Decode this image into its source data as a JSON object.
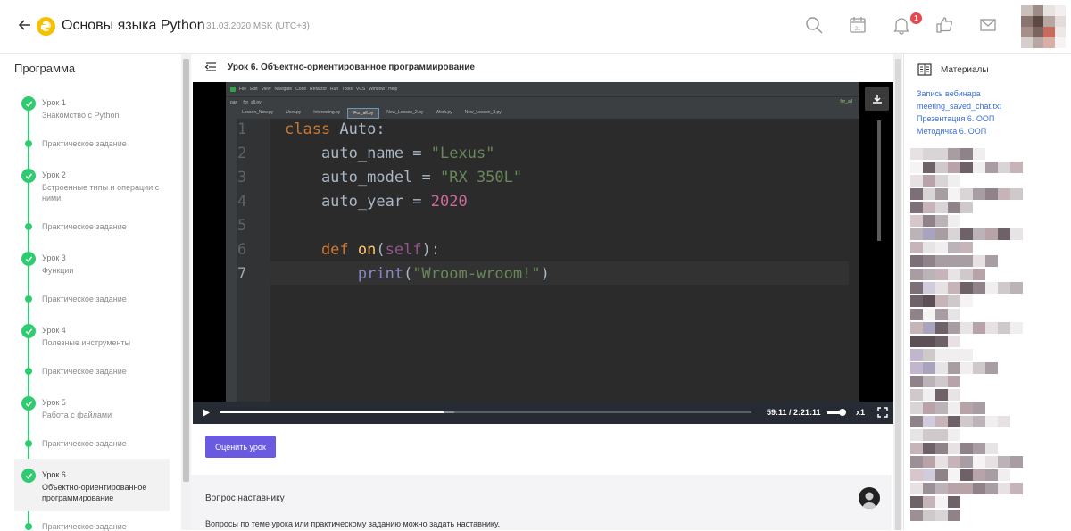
{
  "header": {
    "course_title": "Основы языка Python",
    "course_date": "31.03.2020 MSK (UTC+3)",
    "notification_count": "1"
  },
  "sidebar": {
    "title": "Программа",
    "lessons": [
      {
        "name": "Урок 1",
        "subtitle": "Знакомство с Python",
        "practice": "Практическое задание"
      },
      {
        "name": "Урок 2",
        "subtitle": "Встроенные типы и операции с ними",
        "practice": "Практическое задание"
      },
      {
        "name": "Урок 3",
        "subtitle": "Функции",
        "practice": "Практическое задание"
      },
      {
        "name": "Урок 4",
        "subtitle": "Полезные инструменты",
        "practice": "Практическое задание"
      },
      {
        "name": "Урок 5",
        "subtitle": "Работа с файлами",
        "practice": "Практическое задание"
      },
      {
        "name": "Урок 6",
        "subtitle": "Объектно-ориентированное программирование",
        "practice": "Практическое задание"
      }
    ]
  },
  "main": {
    "lesson_title": "Урок 6. Объектно-ориентированное программирование",
    "rate_button": "Оценить урок",
    "question_title": "Вопрос наставнику",
    "question_text": "Вопросы по теме урока или практическому заданию можно задать наставнику."
  },
  "video": {
    "time": "59:11 / 2:21:11",
    "speed": "x1",
    "progress": 0.42,
    "ide": {
      "menu": [
        "File",
        "Edit",
        "View",
        "Navigate",
        "Code",
        "Refactor",
        "Run",
        "Tools",
        "VCS",
        "Window",
        "Help"
      ],
      "project": "pan",
      "file": "for_all.py",
      "run_config": "for_all",
      "tabs": [
        "Lesson_Now.py",
        "User.py",
        "Interesting.py",
        "For_all.py",
        "New_Lesson_2.py",
        "Work.py",
        "New_Lesson_3.py"
      ],
      "active_tab": 3,
      "line_numbers": [
        "1",
        "2",
        "3",
        "4",
        "5",
        "6",
        "7"
      ],
      "code": {
        "l1_kw": "class",
        "l1_name": " Auto:",
        "l2_name": "    auto_name = ",
        "l2_str": "\"Lexus\"",
        "l3_name": "    auto_model = ",
        "l3_str": "\"RX 350L\"",
        "l4_name": "    auto_year = ",
        "l4_num": "2020",
        "l6_kw": "    def",
        "l6_fn": " on",
        "l6_p1": "(",
        "l6_self": "self",
        "l6_p2": "):",
        "l7_bi": "        print",
        "l7_p1": "(",
        "l7_str": "\"Wroom-wroom!\"",
        "l7_p2": ")"
      }
    }
  },
  "materials": {
    "title": "Материалы",
    "links": [
      "Запись вебинара",
      "meeting_saved_chat.txt",
      "Презентация 6. ООП",
      "Методичка 6. ООП"
    ]
  },
  "colors": {
    "accent": "#6a5ae0",
    "success": "#2ecc71",
    "link": "#3a6fd8",
    "badge": "#e5484d"
  }
}
